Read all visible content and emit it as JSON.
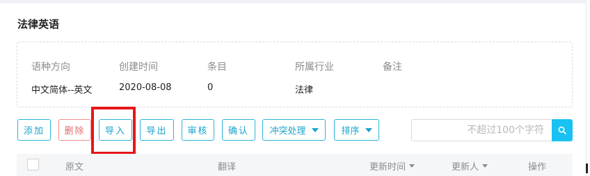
{
  "title": "法律英语",
  "info": {
    "labels": [
      "语种方向",
      "创建时间",
      "条目",
      "所属行业",
      "备注"
    ],
    "values": [
      "中文简体--英文",
      "2020-08-08",
      "0",
      "法律",
      ""
    ]
  },
  "toolbar": {
    "add": "添加",
    "delete": "删除",
    "import": "导入",
    "export": "导出",
    "review": "审核",
    "confirm": "确认",
    "conflict": "冲突处理",
    "sort": "排序"
  },
  "search": {
    "placeholder": "不超过100个字符",
    "value": ""
  },
  "table": {
    "headers": [
      "原文",
      "翻译",
      "更新时间",
      "更新人",
      "操作"
    ]
  },
  "colors": {
    "accent": "#29b4d8",
    "danger": "#f08c8c",
    "highlight": "#e8161a",
    "search_button": "#19c2f0"
  },
  "icons": {
    "search": "search-icon",
    "dropdown": "caret-down-icon"
  }
}
